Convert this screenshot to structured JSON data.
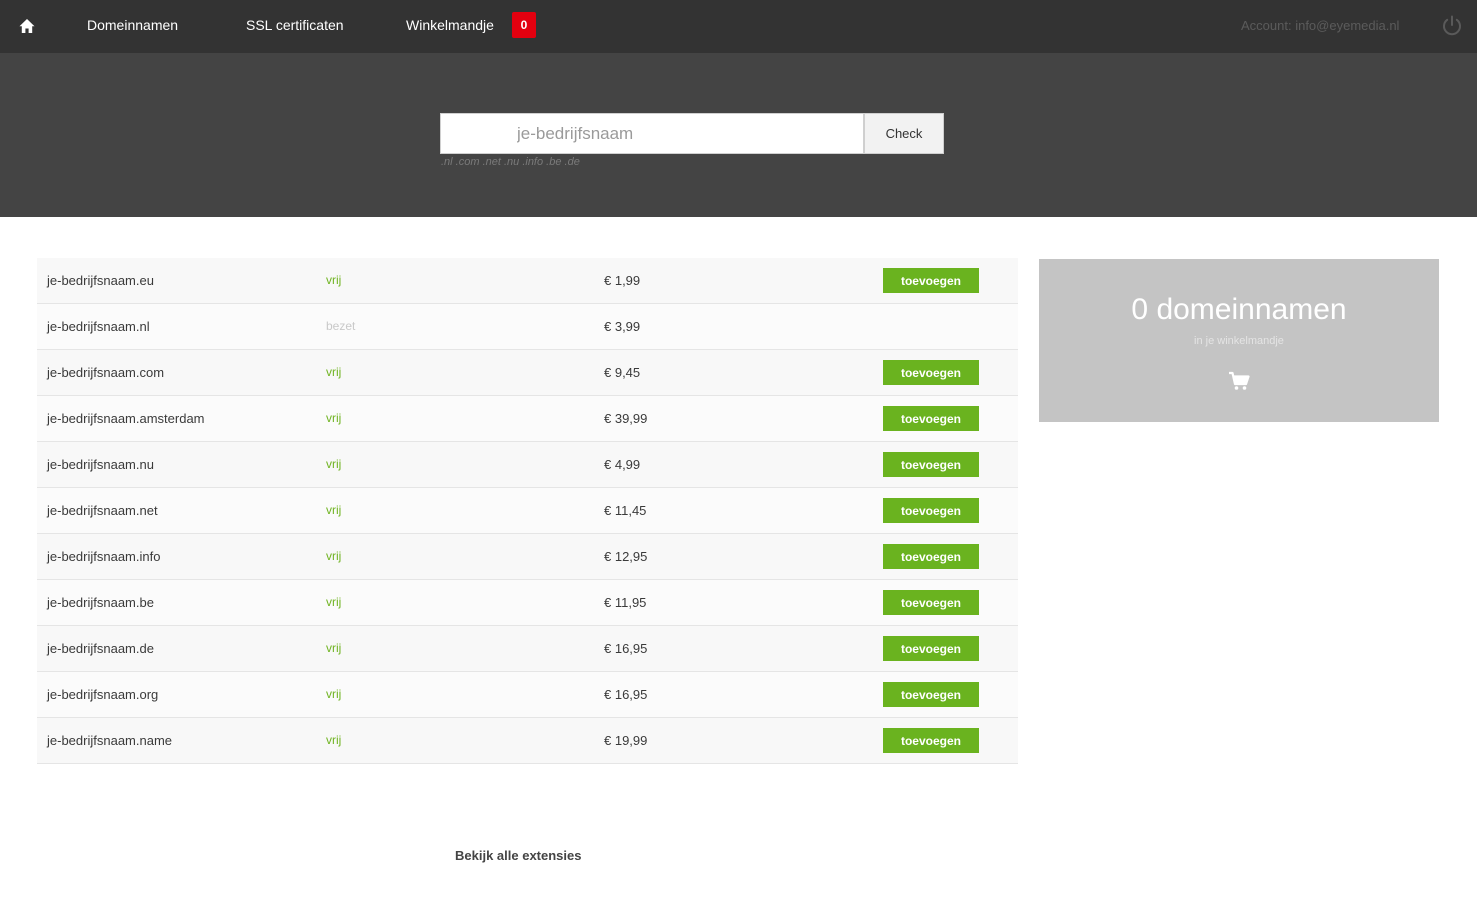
{
  "nav": {
    "items": [
      {
        "label": "Domeinnamen"
      },
      {
        "label": "SSL certificaten"
      },
      {
        "label": "Winkelmandje"
      }
    ],
    "cart_badge": "0",
    "account_label": "Account: info@eyemedia.nl"
  },
  "search": {
    "placeholder": "je-bedrijfsnaam",
    "button_label": "Check",
    "hint": ".nl .com .net .nu .info .be .de"
  },
  "results": {
    "rows": [
      {
        "domain": "je-bedrijfsnaam.eu",
        "status": "vrij",
        "price": "€ 1,99",
        "action": "toevoegen"
      },
      {
        "domain": "je-bedrijfsnaam.nl",
        "status": "bezet",
        "price": "€ 3,99",
        "action": ""
      },
      {
        "domain": "je-bedrijfsnaam.com",
        "status": "vrij",
        "price": "€ 9,45",
        "action": "toevoegen"
      },
      {
        "domain": "je-bedrijfsnaam.amsterdam",
        "status": "vrij",
        "price": "€ 39,99",
        "action": "toevoegen"
      },
      {
        "domain": "je-bedrijfsnaam.nu",
        "status": "vrij",
        "price": "€ 4,99",
        "action": "toevoegen"
      },
      {
        "domain": "je-bedrijfsnaam.net",
        "status": "vrij",
        "price": "€ 11,45",
        "action": "toevoegen"
      },
      {
        "domain": "je-bedrijfsnaam.info",
        "status": "vrij",
        "price": "€ 12,95",
        "action": "toevoegen"
      },
      {
        "domain": "je-bedrijfsnaam.be",
        "status": "vrij",
        "price": "€ 11,95",
        "action": "toevoegen"
      },
      {
        "domain": "je-bedrijfsnaam.de",
        "status": "vrij",
        "price": "€ 16,95",
        "action": "toevoegen"
      },
      {
        "domain": "je-bedrijfsnaam.org",
        "status": "vrij",
        "price": "€ 16,95",
        "action": "toevoegen"
      },
      {
        "domain": "je-bedrijfsnaam.name",
        "status": "vrij",
        "price": "€ 19,99",
        "action": "toevoegen"
      }
    ],
    "view_all_label": "Bekijk alle extensies"
  },
  "cart_summary": {
    "count_label": "0 domeinnamen",
    "sub_label": "in je winkelmandje"
  },
  "icons": {
    "home": "home-icon",
    "power": "power-icon",
    "cart": "cart-icon"
  },
  "colors": {
    "topbar": "#333333",
    "search_band": "#444444",
    "accent_green": "#6ab31f",
    "badge_red": "#e3000f",
    "cart_panel": "#c4c4c4"
  }
}
